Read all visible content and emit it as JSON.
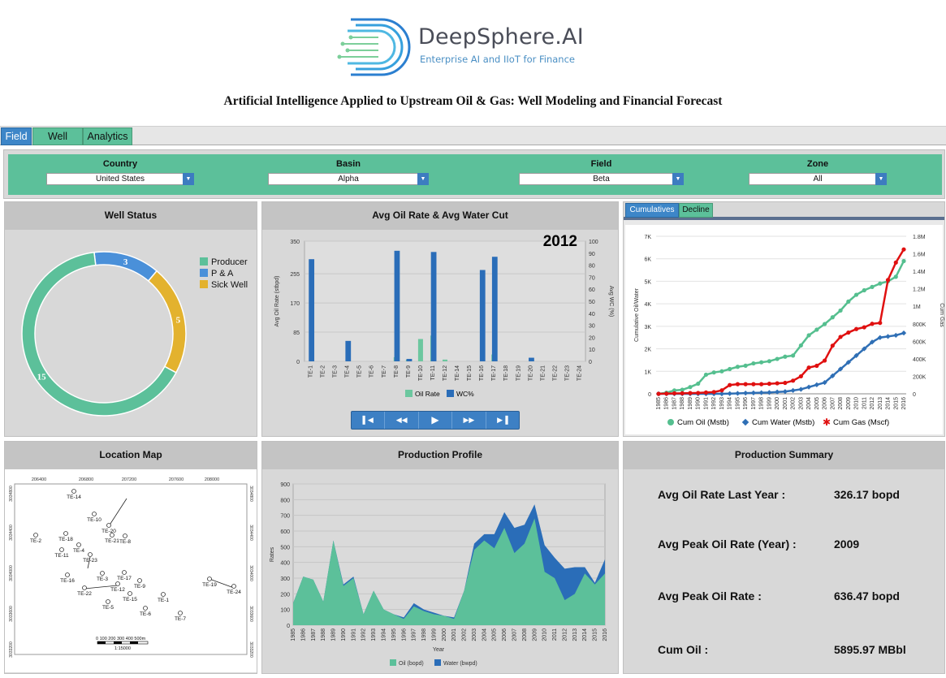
{
  "brand": {
    "name": "DeepSphere.AI",
    "tagline": "Enterprise AI and IIoT for Finance"
  },
  "page_title": "Artificial Intelligence Applied to Upstream Oil & Gas: Well Modeling and Financial Forecast",
  "tabs": [
    "Field",
    "Well",
    "Analytics"
  ],
  "active_tab": "Field",
  "filters": [
    {
      "label": "Country",
      "value": "United States"
    },
    {
      "label": "Basin",
      "value": "Alpha"
    },
    {
      "label": "Field",
      "value": "Beta"
    },
    {
      "label": "Zone",
      "value": "All"
    }
  ],
  "well_status": {
    "title": "Well Status",
    "legend": [
      "Producer",
      "P & A",
      "Sick Well"
    ],
    "colors": {
      "Producer": "#5cc09a",
      "P & A": "#4a90d9",
      "Sick Well": "#e3b22e"
    }
  },
  "avg_oil": {
    "title": "Avg Oil Rate & Avg Water Cut",
    "year": "2012",
    "legend": [
      "Oil Rate",
      "WC%"
    ],
    "yleft_label": "Avg Oil Rate (stbpd)",
    "yright_label": "Avg WC (%)"
  },
  "cum_tabs": [
    "Cumulatives",
    "Decline"
  ],
  "cum_axes": {
    "yleft": "Cumulative Oil/Water",
    "yright": "Cum Gas"
  },
  "cum_legend": [
    "Cum Oil (Mstb)",
    "Cum Water (Mstb)",
    "Cum Gas (Mscf)"
  ],
  "location_map": {
    "title": "Location Map",
    "x_ticks": [
      "206400",
      "206800",
      "207200",
      "207600",
      "208000"
    ],
    "y_ticks": [
      "3034800",
      "3034400",
      "3034000",
      "3033600",
      "3033200"
    ],
    "scale_label": "0   100  200  300  400  500m",
    "scale_ratio": "1:15000",
    "wells": [
      "TE-14",
      "TE-10",
      "TE-20",
      "TE-2",
      "TE-18",
      "TE-21",
      "TE-8",
      "TE-4",
      "TE-11",
      "TE-23",
      "TE-16",
      "TE-3",
      "TE-17",
      "TE-9",
      "TE-22",
      "TE-12",
      "TE-15",
      "TE-1",
      "TE-19",
      "TE-24",
      "TE-5",
      "TE-6",
      "TE-7"
    ]
  },
  "production_profile": {
    "title": "Production Profile",
    "xlabel": "Year",
    "ylabel": "Rates",
    "legend": [
      "Oil (bopd)",
      "Water (bwpd)"
    ]
  },
  "summary": {
    "title": "Production Summary",
    "rows": [
      {
        "label": "Avg Oil Rate Last Year :",
        "value": "326.17 bopd"
      },
      {
        "label": "Avg Peak Oil Rate (Year) :",
        "value": "2009"
      },
      {
        "label": "Avg Peak Oil Rate  :",
        "value": "636.47 bopd"
      },
      {
        "label": "Cum Oil :",
        "value": "5895.97 MBbl"
      }
    ]
  },
  "chart_data": [
    {
      "type": "pie",
      "title": "Well Status",
      "categories": [
        "Producer",
        "P & A",
        "Sick Well"
      ],
      "values": [
        15,
        3,
        5
      ]
    },
    {
      "type": "bar",
      "title": "Avg Oil Rate & Avg Water Cut",
      "categories": [
        "TE-1",
        "TE-2",
        "TE-3",
        "TE-4",
        "TE-5",
        "TE-6",
        "TE-7",
        "TE-8",
        "TE-9",
        "TE-10",
        "TE-11",
        "TE-12",
        "TE-14",
        "TE-15",
        "TE-16",
        "TE-17",
        "TE-18",
        "TE-19",
        "TE-20",
        "TE-21",
        "TE-22",
        "TE-23",
        "TE-24"
      ],
      "series": [
        {
          "name": "Oil Rate",
          "axis": "left",
          "values": [
            0,
            0,
            0,
            0,
            0,
            0,
            0,
            12,
            5,
            65,
            75,
            5,
            0,
            0,
            0,
            20,
            0,
            0,
            0,
            0,
            0,
            0,
            0
          ]
        },
        {
          "name": "WC%",
          "axis": "right",
          "values": [
            85,
            0,
            0,
            17,
            0,
            0,
            0,
            92,
            2,
            0,
            91,
            0,
            0,
            0,
            76,
            87,
            0,
            0,
            3,
            0,
            0,
            0,
            0
          ]
        }
      ],
      "ylim_left": [
        0,
        350
      ],
      "ylim_right": [
        0,
        100
      ],
      "yticks_left": [
        0,
        85,
        170,
        255,
        350
      ],
      "yticks_right": [
        0,
        10,
        20,
        30,
        40,
        50,
        60,
        70,
        80,
        90,
        100
      ]
    },
    {
      "type": "line",
      "title": "Cumulatives",
      "x": [
        "1985",
        "1986",
        "1987",
        "1988",
        "1989",
        "1990",
        "1991",
        "1992",
        "1993",
        "1994",
        "1995",
        "1996",
        "1997",
        "1998",
        "1999",
        "2000",
        "2001",
        "2002",
        "2003",
        "2004",
        "2005",
        "2006",
        "2007",
        "2008",
        "2009",
        "2010",
        "2011",
        "2012",
        "2013",
        "2014",
        "2015",
        "2016"
      ],
      "series": [
        {
          "name": "Cum Oil (Mstb)",
          "axis": "left",
          "values": [
            0,
            50,
            150,
            180,
            300,
            450,
            850,
            950,
            1000,
            1100,
            1200,
            1250,
            1350,
            1400,
            1450,
            1550,
            1650,
            1700,
            2150,
            2600,
            2850,
            3100,
            3400,
            3700,
            4100,
            4400,
            4600,
            4750,
            4900,
            5000,
            5200,
            5900
          ]
        },
        {
          "name": "Cum Water (Mstb)",
          "axis": "left",
          "values": [
            0,
            0,
            0,
            0,
            0,
            0,
            0,
            0,
            0,
            10,
            20,
            30,
            40,
            50,
            60,
            80,
            100,
            150,
            200,
            300,
            400,
            500,
            800,
            1100,
            1400,
            1700,
            2000,
            2300,
            2500,
            2550,
            2600,
            2700
          ]
        },
        {
          "name": "Cum Gas (Mscf)",
          "axis": "right",
          "values": [
            0,
            2000,
            5000,
            6000,
            8000,
            10000,
            15000,
            20000,
            40000,
            100000,
            110000,
            110000,
            110000,
            110000,
            115000,
            120000,
            125000,
            150000,
            200000,
            300000,
            320000,
            380000,
            550000,
            650000,
            700000,
            740000,
            760000,
            800000,
            810000,
            1300000,
            1500000,
            1650000
          ]
        }
      ],
      "ylim_left": [
        0,
        7000
      ],
      "ylim_right": [
        0,
        1800000
      ],
      "yticks_left": [
        "0",
        "1K",
        "2K",
        "3K",
        "4K",
        "5K",
        "6K",
        "7K"
      ],
      "yticks_right": [
        "0",
        "200K",
        "400K",
        "600K",
        "800K",
        "1M",
        "1.2M",
        "1.4M",
        "1.6M",
        "1.8M"
      ]
    },
    {
      "type": "area",
      "title": "Production Profile",
      "x": [
        "1985",
        "1986",
        "1987",
        "1988",
        "1989",
        "1990",
        "1991",
        "1992",
        "1993",
        "1994",
        "1995",
        "1996",
        "1997",
        "1998",
        "1999",
        "2000",
        "2001",
        "2002",
        "2003",
        "2004",
        "2005",
        "2006",
        "2007",
        "2008",
        "2009",
        "2010",
        "2011",
        "2012",
        "2013",
        "2014",
        "2015",
        "2016"
      ],
      "series": [
        {
          "name": "Oil (bopd)",
          "values": [
            140,
            310,
            290,
            150,
            540,
            250,
            300,
            70,
            220,
            100,
            70,
            40,
            120,
            90,
            70,
            60,
            40,
            220,
            480,
            540,
            490,
            620,
            460,
            520,
            680,
            340,
            300,
            160,
            200,
            330,
            260,
            330
          ]
        },
        {
          "name": "Water (bwpd)",
          "values": [
            0,
            0,
            0,
            0,
            0,
            10,
            10,
            0,
            0,
            0,
            0,
            10,
            20,
            10,
            10,
            0,
            10,
            0,
            40,
            40,
            90,
            100,
            160,
            120,
            90,
            170,
            130,
            200,
            170,
            40,
            10,
            90
          ]
        }
      ],
      "ylim": [
        0,
        900
      ],
      "yticks": [
        0,
        100,
        200,
        300,
        400,
        500,
        600,
        700,
        800,
        900
      ]
    }
  ]
}
